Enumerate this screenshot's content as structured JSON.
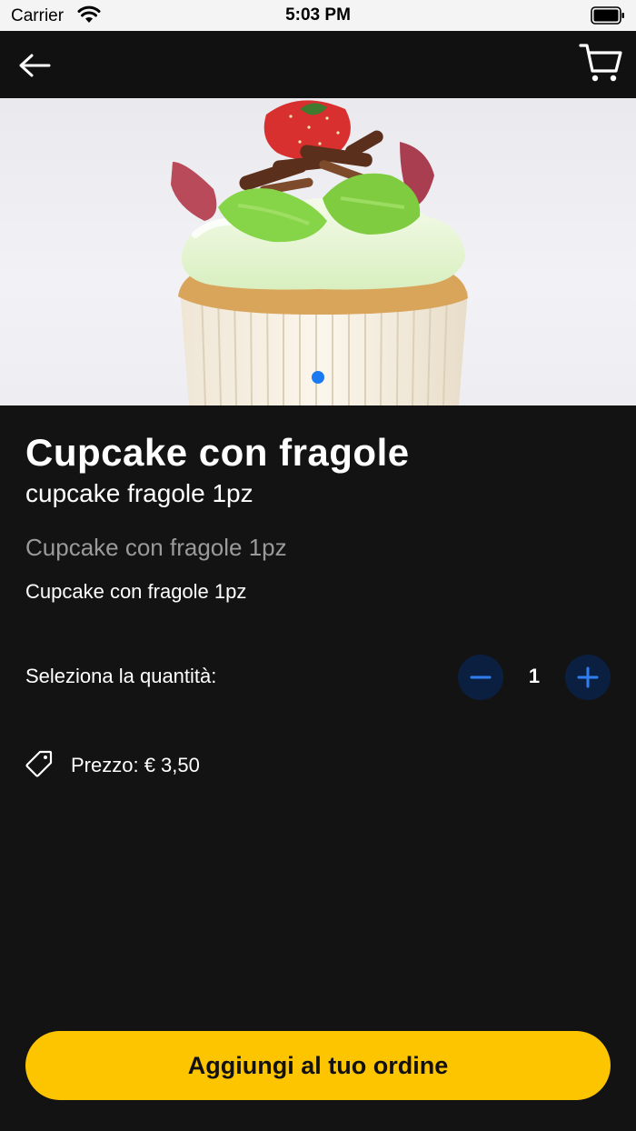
{
  "status_bar": {
    "carrier": "Carrier",
    "time": "5:03 PM"
  },
  "nav": {
    "back_icon": "arrow-left-icon",
    "cart_icon": "cart-icon"
  },
  "product": {
    "title": "Cupcake con fragole",
    "subtitle": "cupcake fragole 1pz",
    "short_description": "Cupcake con fragole 1pz",
    "description": "Cupcake con fragole 1pz",
    "image_pages": 1,
    "active_page": 1
  },
  "quantity": {
    "label": "Seleziona la quantità:",
    "value": "1",
    "minus_icon": "minus-icon",
    "plus_icon": "plus-icon"
  },
  "price": {
    "text": "Prezzo: € 3,50",
    "icon": "price-tag-icon"
  },
  "cta": {
    "label": "Aggiungi al tuo ordine"
  },
  "colors": {
    "background": "#131313",
    "accent": "#fdc500",
    "stepper": "#0b2040",
    "stepper_icon": "#2f7ff0",
    "page_dot": "#1a7af2"
  }
}
